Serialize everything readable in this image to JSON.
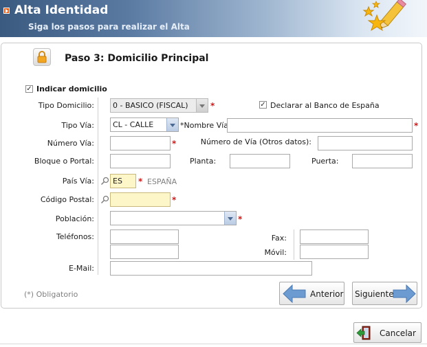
{
  "header": {
    "title": "Alta Identidad",
    "subtitle": "Siga los pasos para realizar el Alta"
  },
  "step": {
    "title": "Paso 3: Domicilio Principal"
  },
  "form": {
    "indicar_domicilio": {
      "label": "Indicar domicilio",
      "checked": true
    },
    "tipo_domicilio": {
      "label": "Tipo Domicilio:",
      "value": "0 - BASICO (FISCAL)"
    },
    "declarar_banco": {
      "label": "Declarar al Banco de España",
      "checked": true
    },
    "tipo_via": {
      "label": "Tipo Vía:",
      "value": "CL - CALLE"
    },
    "nombre_via": {
      "label": "*Nombre Vía:",
      "value": ""
    },
    "numero_via": {
      "label": "Número Vía:",
      "value": ""
    },
    "numero_via_otros": {
      "label": "Número de Vía (Otros datos):",
      "value": ""
    },
    "bloque_portal": {
      "label": "Bloque o Portal:",
      "value": ""
    },
    "planta": {
      "label": "Planta:",
      "value": ""
    },
    "puerta": {
      "label": "Puerta:",
      "value": ""
    },
    "pais_via": {
      "label": "País Vía:",
      "value": "ES",
      "description": "ESPAÑA"
    },
    "codigo_postal": {
      "label": "Código Postal:",
      "value": ""
    },
    "poblacion": {
      "label": "Población:",
      "value": ""
    },
    "telefonos": {
      "label": "Teléfonos:",
      "value1": "",
      "value2": ""
    },
    "fax": {
      "label": "Fax:",
      "value": ""
    },
    "movil": {
      "label": "Móvil:",
      "value": ""
    },
    "email": {
      "label": "E-Mail:",
      "value": ""
    },
    "required_marker": "*"
  },
  "footer": {
    "obligatorio_note": "(*) Obligatorio",
    "anterior_label": "Anterior",
    "siguiente_label": "Siguiente",
    "cancelar_label": "Cancelar"
  },
  "colors": {
    "header_dark": "#3b5a80",
    "accent_orange": "#e9601b",
    "required_red": "#d01818",
    "arrow_blue": "#6b9bd1",
    "highlight_yellow": "#fdf6c8"
  },
  "icons": {
    "header_bullet": "arrow-bullet-icon",
    "header_art": "stars-pencil-icon",
    "step": "lock-icon",
    "lookup": "search-icon",
    "anterior": "arrow-left-icon",
    "siguiente": "arrow-right-icon",
    "cancelar": "exit-door-icon"
  }
}
